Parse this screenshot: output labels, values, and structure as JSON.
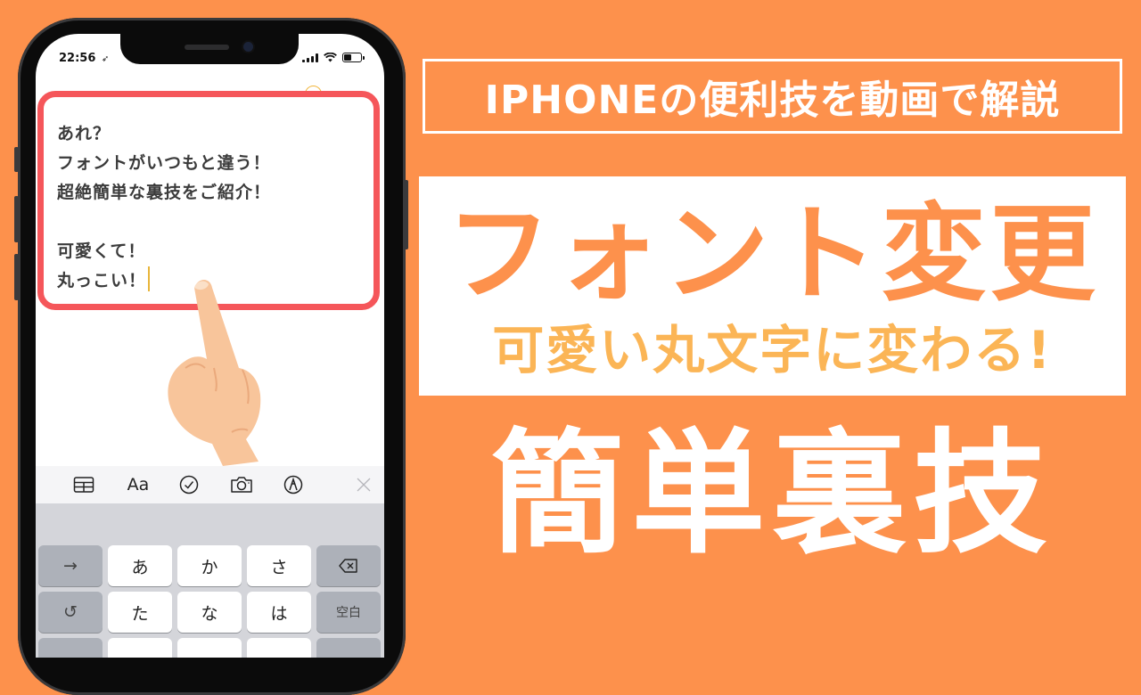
{
  "phone": {
    "status_bar": {
      "time": "22:56",
      "location_icon": "location-arrow-icon",
      "signal_icon": "cellular-signal-icon",
      "wifi_icon": "wifi-icon",
      "battery_icon": "battery-icon"
    },
    "note": {
      "lines": [
        "あれ？",
        "フォントがいつもと違う！",
        "超絶簡単な裏技をご紹介！",
        "",
        "可愛くて！",
        "丸っこい！"
      ]
    },
    "toolbar": {
      "items": [
        {
          "icon": "table-icon",
          "label": "▦"
        },
        {
          "icon": "text-format-icon",
          "label": "Aa"
        },
        {
          "icon": "checklist-icon",
          "label": "✓"
        },
        {
          "icon": "camera-icon",
          "label": "📷"
        },
        {
          "icon": "markup-pen-icon",
          "label": "✎"
        },
        {
          "icon": "close-icon",
          "label": "✕"
        }
      ]
    },
    "keyboard": {
      "row1": [
        "→",
        "あ",
        "か",
        "さ",
        "⌫"
      ],
      "row2": [
        "↺",
        "た",
        "な",
        "は",
        "空白"
      ]
    }
  },
  "banner": {
    "top": "IPHONEの便利技を動画で解説",
    "main": "フォント変更",
    "sub": "可愛い丸文字に変わる!",
    "bottom": "簡単裏技"
  },
  "colors": {
    "background": "#fd914c",
    "highlight": "#f5565a",
    "main_title": "#fd914c",
    "sub_title": "#fbb556",
    "cursor": "#e8b53a"
  }
}
